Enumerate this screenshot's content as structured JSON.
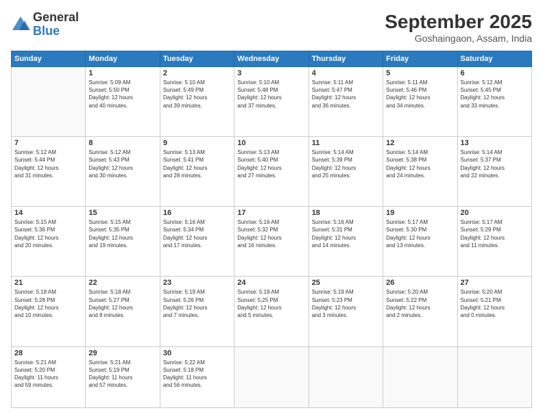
{
  "logo": {
    "general": "General",
    "blue": "Blue"
  },
  "header": {
    "month": "September 2025",
    "location": "Goshaingaon, Assam, India"
  },
  "weekdays": [
    "Sunday",
    "Monday",
    "Tuesday",
    "Wednesday",
    "Thursday",
    "Friday",
    "Saturday"
  ],
  "weeks": [
    [
      {
        "day": null,
        "info": null
      },
      {
        "day": "1",
        "info": "Sunrise: 5:09 AM\nSunset: 5:50 PM\nDaylight: 12 hours\nand 40 minutes."
      },
      {
        "day": "2",
        "info": "Sunrise: 5:10 AM\nSunset: 5:49 PM\nDaylight: 12 hours\nand 39 minutes."
      },
      {
        "day": "3",
        "info": "Sunrise: 5:10 AM\nSunset: 5:48 PM\nDaylight: 12 hours\nand 37 minutes."
      },
      {
        "day": "4",
        "info": "Sunrise: 5:11 AM\nSunset: 5:47 PM\nDaylight: 12 hours\nand 36 minutes."
      },
      {
        "day": "5",
        "info": "Sunrise: 5:11 AM\nSunset: 5:46 PM\nDaylight: 12 hours\nand 34 minutes."
      },
      {
        "day": "6",
        "info": "Sunrise: 5:12 AM\nSunset: 5:45 PM\nDaylight: 12 hours\nand 33 minutes."
      }
    ],
    [
      {
        "day": "7",
        "info": "Sunrise: 5:12 AM\nSunset: 5:44 PM\nDaylight: 12 hours\nand 31 minutes."
      },
      {
        "day": "8",
        "info": "Sunrise: 5:12 AM\nSunset: 5:43 PM\nDaylight: 12 hours\nand 30 minutes."
      },
      {
        "day": "9",
        "info": "Sunrise: 5:13 AM\nSunset: 5:41 PM\nDaylight: 12 hours\nand 28 minutes."
      },
      {
        "day": "10",
        "info": "Sunrise: 5:13 AM\nSunset: 5:40 PM\nDaylight: 12 hours\nand 27 minutes."
      },
      {
        "day": "11",
        "info": "Sunrise: 5:14 AM\nSunset: 5:39 PM\nDaylight: 12 hours\nand 25 minutes."
      },
      {
        "day": "12",
        "info": "Sunrise: 5:14 AM\nSunset: 5:38 PM\nDaylight: 12 hours\nand 24 minutes."
      },
      {
        "day": "13",
        "info": "Sunrise: 5:14 AM\nSunset: 5:37 PM\nDaylight: 12 hours\nand 22 minutes."
      }
    ],
    [
      {
        "day": "14",
        "info": "Sunrise: 5:15 AM\nSunset: 5:36 PM\nDaylight: 12 hours\nand 20 minutes."
      },
      {
        "day": "15",
        "info": "Sunrise: 5:15 AM\nSunset: 5:35 PM\nDaylight: 12 hours\nand 19 minutes."
      },
      {
        "day": "16",
        "info": "Sunrise: 5:16 AM\nSunset: 5:34 PM\nDaylight: 12 hours\nand 17 minutes."
      },
      {
        "day": "17",
        "info": "Sunrise: 5:16 AM\nSunset: 5:32 PM\nDaylight: 12 hours\nand 16 minutes."
      },
      {
        "day": "18",
        "info": "Sunrise: 5:16 AM\nSunset: 5:31 PM\nDaylight: 12 hours\nand 14 minutes."
      },
      {
        "day": "19",
        "info": "Sunrise: 5:17 AM\nSunset: 5:30 PM\nDaylight: 12 hours\nand 13 minutes."
      },
      {
        "day": "20",
        "info": "Sunrise: 5:17 AM\nSunset: 5:29 PM\nDaylight: 12 hours\nand 11 minutes."
      }
    ],
    [
      {
        "day": "21",
        "info": "Sunrise: 5:18 AM\nSunset: 5:28 PM\nDaylight: 12 hours\nand 10 minutes."
      },
      {
        "day": "22",
        "info": "Sunrise: 5:18 AM\nSunset: 5:27 PM\nDaylight: 12 hours\nand 8 minutes."
      },
      {
        "day": "23",
        "info": "Sunrise: 5:19 AM\nSunset: 5:26 PM\nDaylight: 12 hours\nand 7 minutes."
      },
      {
        "day": "24",
        "info": "Sunrise: 5:19 AM\nSunset: 5:25 PM\nDaylight: 12 hours\nand 5 minutes."
      },
      {
        "day": "25",
        "info": "Sunrise: 5:19 AM\nSunset: 5:23 PM\nDaylight: 12 hours\nand 3 minutes."
      },
      {
        "day": "26",
        "info": "Sunrise: 5:20 AM\nSunset: 5:22 PM\nDaylight: 12 hours\nand 2 minutes."
      },
      {
        "day": "27",
        "info": "Sunrise: 5:20 AM\nSunset: 5:21 PM\nDaylight: 12 hours\nand 0 minutes."
      }
    ],
    [
      {
        "day": "28",
        "info": "Sunrise: 5:21 AM\nSunset: 5:20 PM\nDaylight: 11 hours\nand 59 minutes."
      },
      {
        "day": "29",
        "info": "Sunrise: 5:21 AM\nSunset: 5:19 PM\nDaylight: 11 hours\nand 57 minutes."
      },
      {
        "day": "30",
        "info": "Sunrise: 5:22 AM\nSunset: 5:18 PM\nDaylight: 11 hours\nand 56 minutes."
      },
      {
        "day": null,
        "info": null
      },
      {
        "day": null,
        "info": null
      },
      {
        "day": null,
        "info": null
      },
      {
        "day": null,
        "info": null
      }
    ]
  ]
}
